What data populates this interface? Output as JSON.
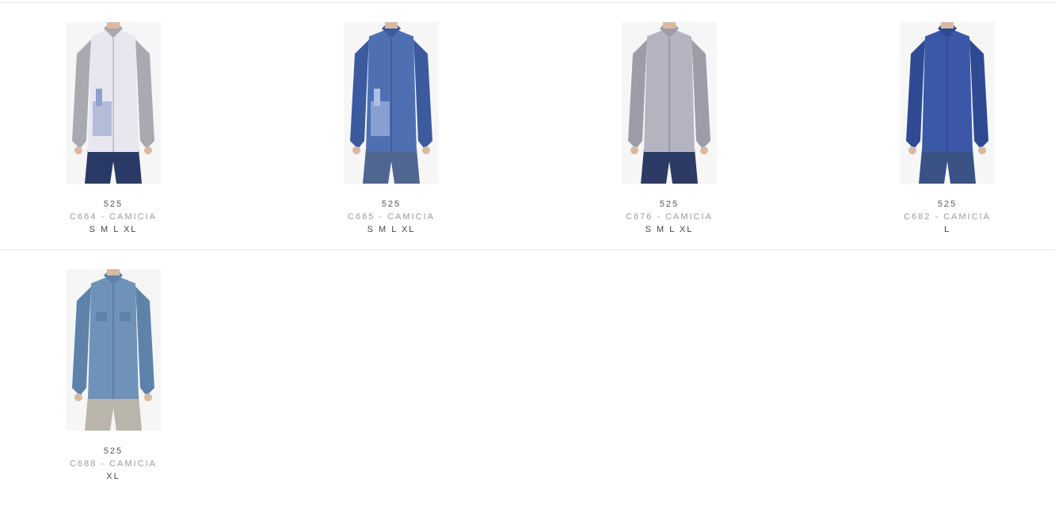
{
  "products": [
    {
      "brand": "525",
      "name": "C664 - CAMICIA",
      "sizes": "S M L XL",
      "image_icon": "shirt-patchwork-grey-white-icon",
      "colors": {
        "body": "#e8e6ef",
        "sleeve": "#a9a9b0",
        "pants": "#2a3a66",
        "patch": "#8fa0c9"
      }
    },
    {
      "brand": "525",
      "name": "C665 - CAMICIA",
      "sizes": "S M L XL",
      "image_icon": "shirt-denim-blue-patch-icon",
      "colors": {
        "body": "#4f6fb3",
        "sleeve": "#3c5a9e",
        "pants": "#4e6690",
        "patch": "#aebfe4"
      }
    },
    {
      "brand": "525",
      "name": "C676 - CAMICIA",
      "sizes": "S M L XL",
      "image_icon": "shirt-grey-check-icon",
      "colors": {
        "body": "#b3b4bf",
        "sleeve": "#9c9da8",
        "pants": "#2b3b66",
        "patch": "#b3b4bf"
      }
    },
    {
      "brand": "525",
      "name": "C682 - CAMICIA",
      "sizes": "L",
      "image_icon": "shirt-dark-denim-icon",
      "colors": {
        "body": "#3b58a8",
        "sleeve": "#2f4a92",
        "pants": "#3a5384",
        "patch": "#3b58a8"
      }
    },
    {
      "brand": "525",
      "name": "C688 - CAMICIA",
      "sizes": "XL",
      "image_icon": "shirt-washed-denim-icon",
      "colors": {
        "body": "#6f93b8",
        "sleeve": "#5d83ab",
        "pants": "#b9b5ab",
        "patch": "#6f93b8"
      }
    }
  ]
}
